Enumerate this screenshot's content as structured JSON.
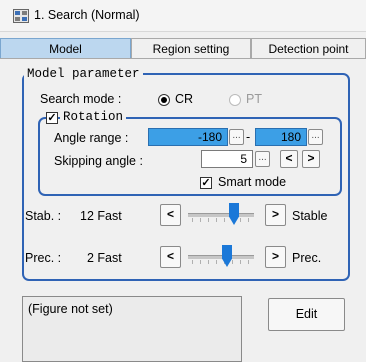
{
  "window": {
    "title": "1. Search (Normal)",
    "icon": "search-window-icon"
  },
  "tabs": [
    {
      "label": "Model",
      "active": true
    },
    {
      "label": "Region setting",
      "active": false
    },
    {
      "label": "Detection point",
      "active": false
    }
  ],
  "model_parameter": {
    "legend": "Model parameter",
    "search_mode": {
      "label": "Search mode :",
      "options": [
        "CR",
        "PT"
      ],
      "selected": "CR"
    },
    "rotation": {
      "legend": "Rotation",
      "checked": true,
      "angle_range": {
        "label": "Angle range :",
        "min": "-180",
        "separator": "-",
        "max": "180"
      },
      "skipping_angle": {
        "label": "Skipping angle :",
        "value": "5",
        "prev": "<",
        "next": ">"
      },
      "smart_mode": {
        "label": "Smart mode",
        "checked": true
      }
    },
    "stab": {
      "label": "Stab. :",
      "value": "12 Fast",
      "left_btn": "<",
      "right_btn": ">",
      "right_label": "Stable",
      "level": 0.73
    },
    "prec": {
      "label": "Prec. :",
      "value": "2 Fast",
      "left_btn": "<",
      "right_btn": ">",
      "right_label": "Prec.",
      "level": 0.6
    }
  },
  "figure": {
    "status": "(Figure not set)"
  },
  "edit_button": "Edit",
  "colors": {
    "group_border": "#2f63b5",
    "active_tab": "#bcd7ef",
    "field_highlight": "#3c9fe6",
    "slider_thumb": "#1b78d8"
  },
  "mini_button_glyph": "..."
}
